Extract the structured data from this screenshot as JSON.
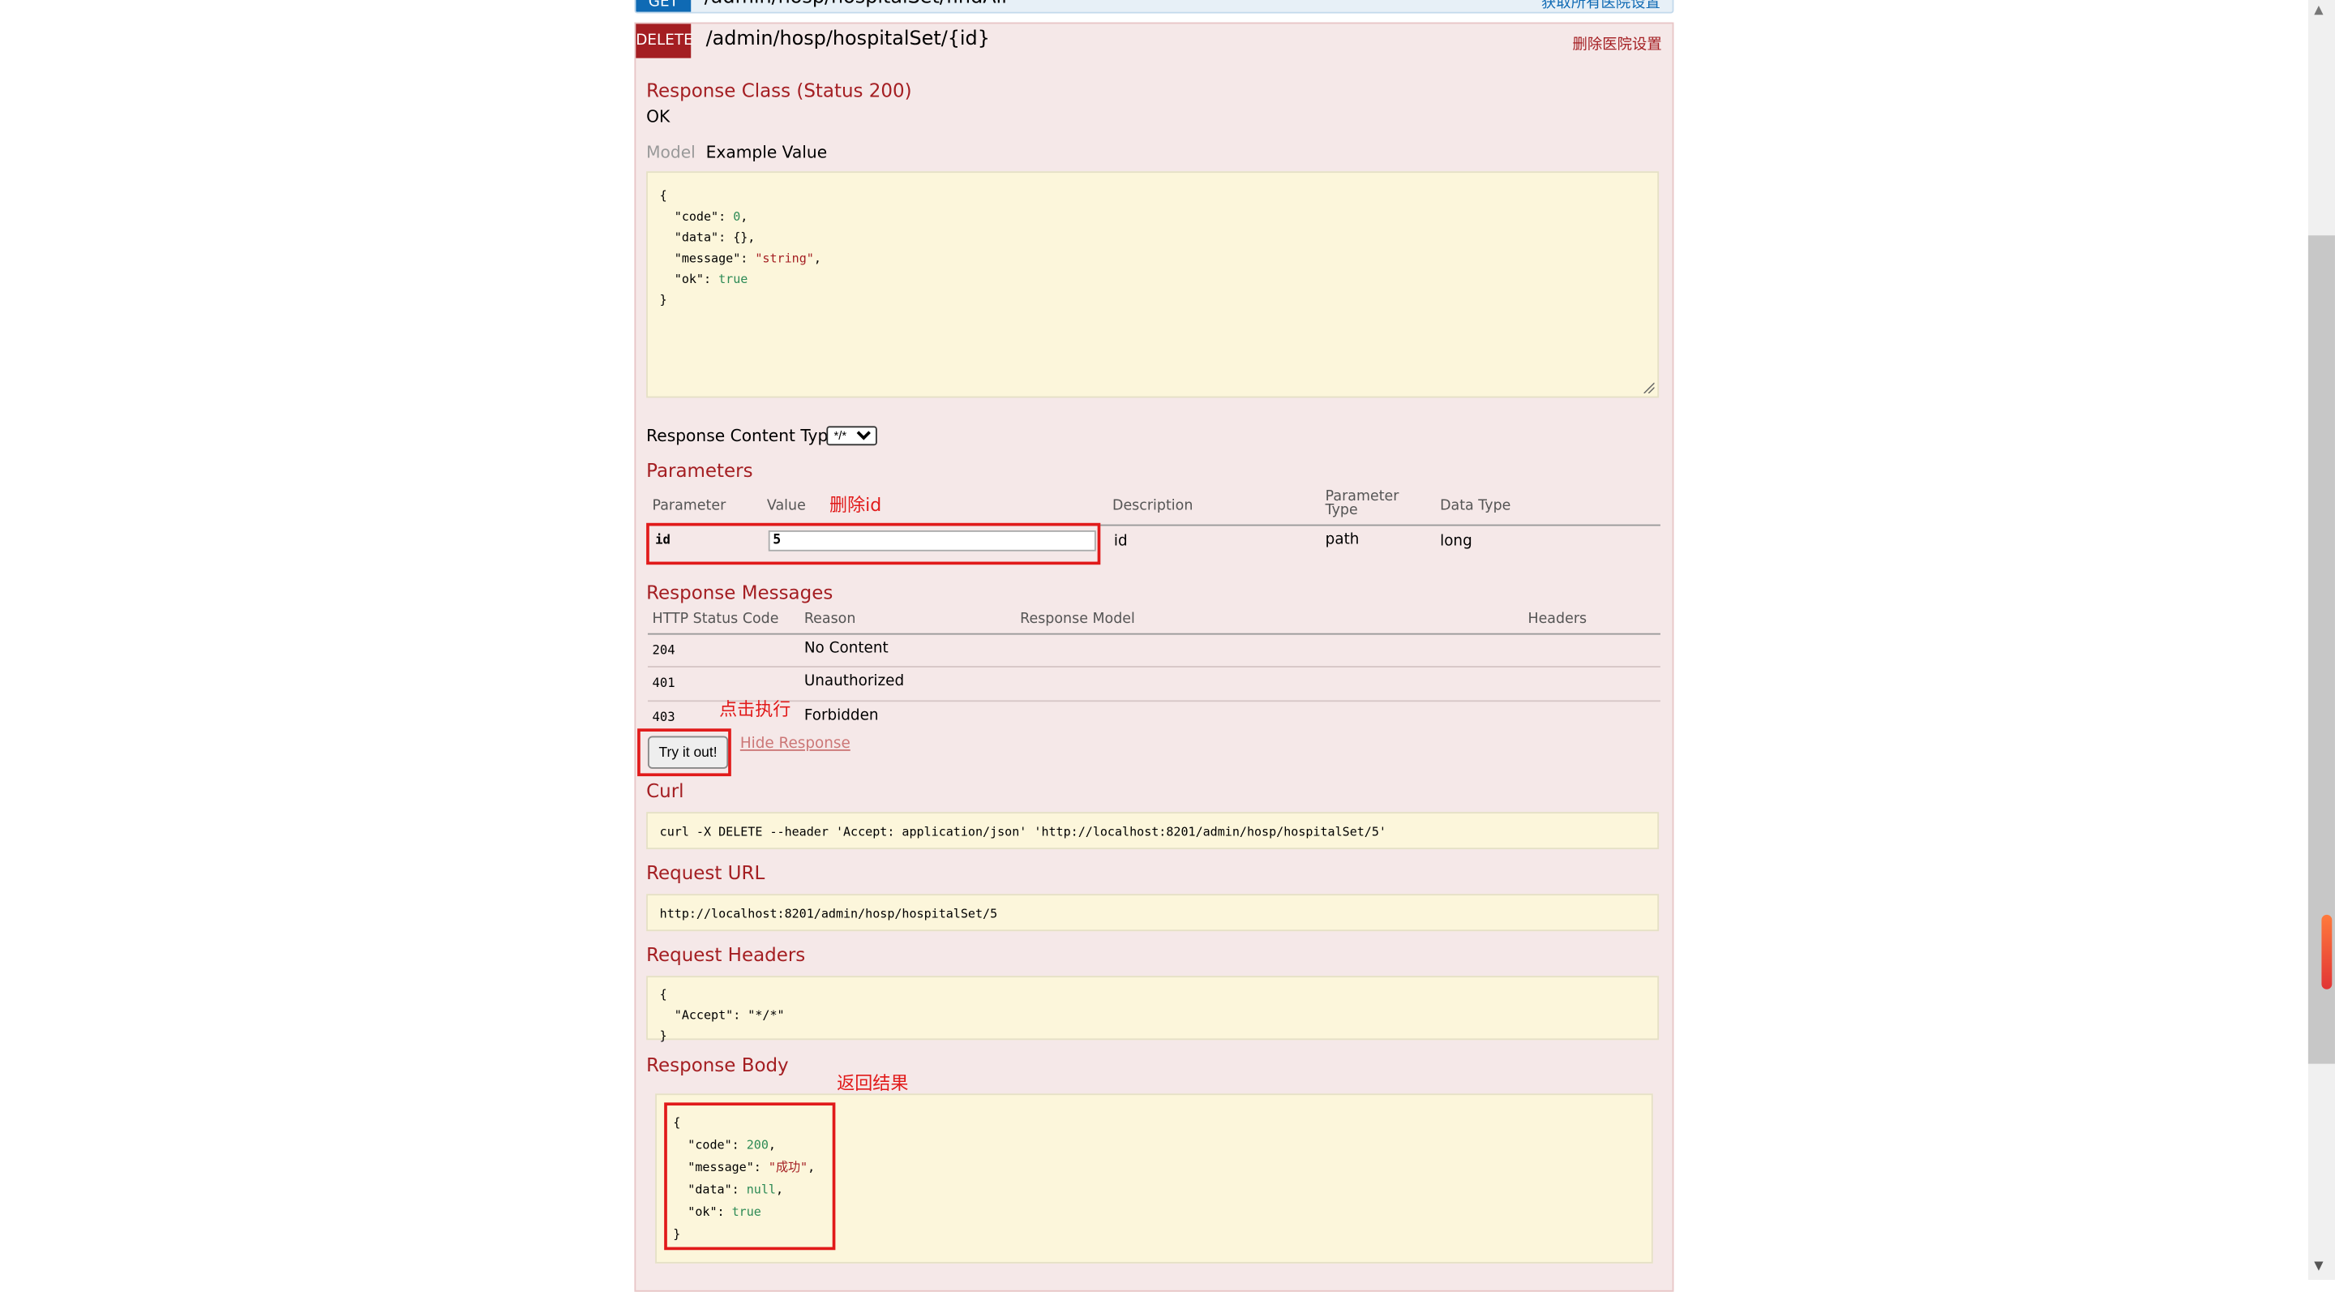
{
  "get_op": {
    "badge": "GET",
    "path": "/admin/hosp/hospitalSet/findAll",
    "summary": "获取所有医院设置"
  },
  "delete_op": {
    "badge": "DELETE",
    "path": "/admin/hosp/hospitalSet/{id}",
    "summary": "删除医院设置",
    "response_class_title": "Response Class (Status 200)",
    "response_class_value": "OK",
    "tabs": {
      "model": "Model",
      "example": "Example Value"
    },
    "example_json": [
      "{",
      "  \"code\": 0,",
      "  \"data\": {},",
      "  \"message\": \"string\",",
      "  \"ok\": true",
      "}"
    ],
    "content_type_label": "Response Content Type",
    "content_type_value": "*/*",
    "parameters_title": "Parameters",
    "parameters": {
      "headers": [
        "Parameter",
        "Value",
        "Description",
        "Parameter\nType",
        "Data Type"
      ],
      "row": {
        "name": "id",
        "value": "5",
        "description": "id",
        "type": "path",
        "data_type": "long"
      }
    },
    "messages_title": "Response Messages",
    "messages": {
      "headers": [
        "HTTP Status Code",
        "Reason",
        "Response Model",
        "Headers"
      ],
      "rows": [
        {
          "code": "204",
          "reason": "No Content"
        },
        {
          "code": "401",
          "reason": "Unauthorized"
        },
        {
          "code": "403",
          "reason": "Forbidden"
        }
      ]
    },
    "try_button": "Try it out!",
    "hide_response": "Hide Response",
    "curl_title": "Curl",
    "curl": "curl -X DELETE --header 'Accept: application/json' 'http://localhost:8201/admin/hosp/hospitalSet/5'",
    "request_url_title": "Request URL",
    "request_url": "http://localhost:8201/admin/hosp/hospitalSet/5",
    "request_headers_title": "Request Headers",
    "request_headers": [
      "{",
      "  \"Accept\": \"*/*\"",
      "}"
    ],
    "response_body_title": "Response Body",
    "response_body": [
      "{",
      "  \"code\": 200,",
      "  \"message\": \"成功\",",
      "  \"data\": null,",
      "  \"ok\": true",
      "}"
    ]
  },
  "annotations": {
    "delete_id": "删除id",
    "click_execute": "点击执行",
    "return_result": "返回结果"
  },
  "colors": {
    "delete": "#a41e22",
    "get": "#0f6ab4",
    "annotation": "#e11a1a",
    "json_bg": "#fcf6db",
    "panel_bg": "#f5e8e8"
  }
}
